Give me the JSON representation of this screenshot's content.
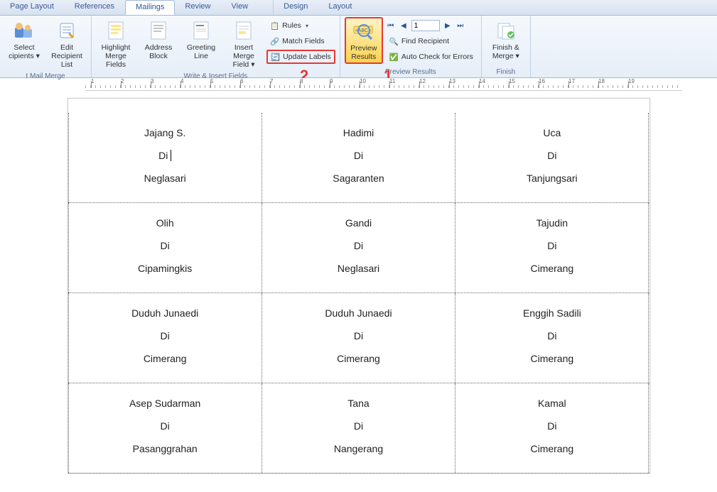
{
  "tabs": {
    "page_layout": "Page Layout",
    "references": "References",
    "mailings": "Mailings",
    "review": "Review",
    "view": "View",
    "design": "Design",
    "layout": "Layout"
  },
  "ribbon": {
    "select_recipients": "Select\ncipients ▾",
    "edit_recipient_list": "Edit\nRecipient List",
    "group_start": "t Mail Merge",
    "highlight_merge_fields": "Highlight\nMerge Fields",
    "address_block": "Address\nBlock",
    "greeting_line": "Greeting\nLine",
    "insert_merge_field": "Insert Merge\nField ▾",
    "rules": "Rules",
    "match_fields": "Match Fields",
    "update_labels": "Update Labels",
    "group_write": "Write & Insert Fields",
    "preview_results": "Preview\nResults",
    "find_recipient": "Find Recipient",
    "auto_check": "Auto Check for Errors",
    "group_preview": "Preview Results",
    "record_value": "1",
    "finish_merge": "Finish &\nMerge ▾",
    "group_finish": "Finish"
  },
  "annotations": {
    "num1": "1",
    "num2": "2"
  },
  "ruler_start": 1,
  "labels": [
    [
      {
        "name": "Jajang S.",
        "di": "Di",
        "place": "Neglasari",
        "cursor": true
      },
      {
        "name": "Hadimi",
        "di": "Di",
        "place": "Sagaranten"
      },
      {
        "name": "Uca",
        "di": "Di",
        "place": "Tanjungsari"
      }
    ],
    [
      {
        "name": "Olih",
        "di": "Di",
        "place": "Cipamingkis"
      },
      {
        "name": "Gandi",
        "di": "Di",
        "place": "Neglasari"
      },
      {
        "name": "Tajudin",
        "di": "Di",
        "place": "Cimerang"
      }
    ],
    [
      {
        "name": "Duduh Junaedi",
        "di": "Di",
        "place": "Cimerang"
      },
      {
        "name": "Duduh Junaedi",
        "di": "Di",
        "place": "Cimerang"
      },
      {
        "name": "Enggih Sadili",
        "di": "Di",
        "place": "Cimerang"
      }
    ],
    [
      {
        "name": "Asep Sudarman",
        "di": "Di",
        "place": "Pasanggrahan"
      },
      {
        "name": "Tana",
        "di": "Di",
        "place": "Nangerang"
      },
      {
        "name": "Kamal",
        "di": "Di",
        "place": "Cimerang"
      }
    ]
  ]
}
